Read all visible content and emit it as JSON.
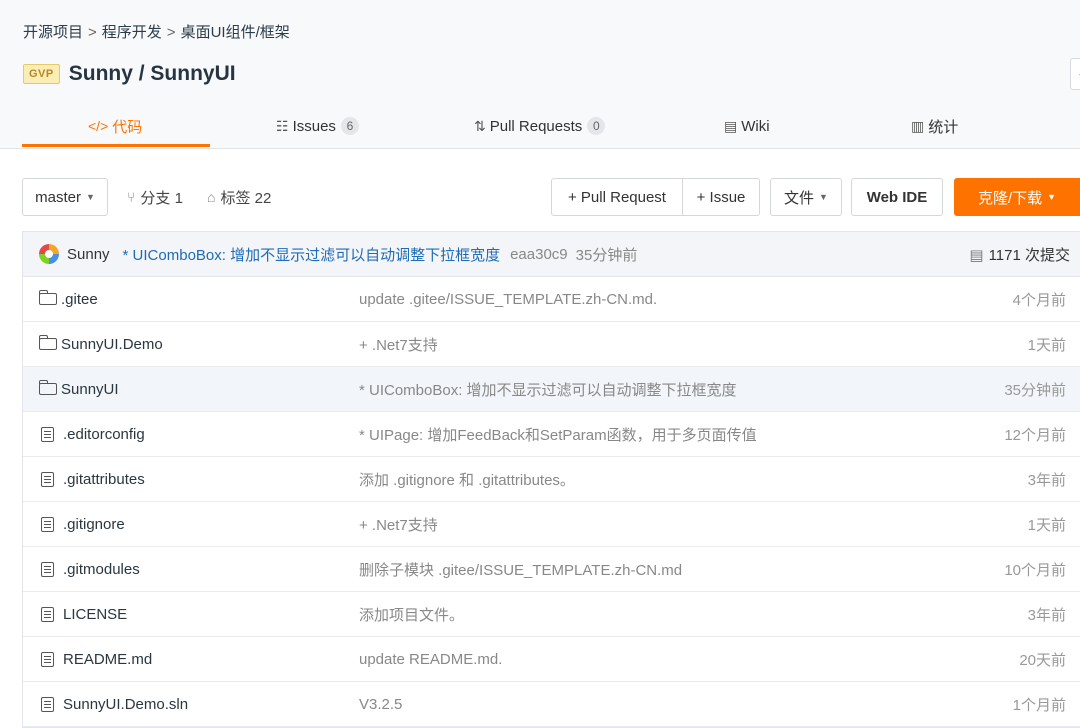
{
  "breadcrumb": [
    "开源项目",
    "程序开发",
    "桌面UI组件/框架"
  ],
  "repo": {
    "badge": "GVP",
    "title": "Sunny / SunnyUI"
  },
  "tabs": [
    {
      "icon": "</>",
      "label": "代码",
      "count": ""
    },
    {
      "icon": "☷",
      "label": "Issues",
      "count": "6"
    },
    {
      "icon": "⇅",
      "label": "Pull Requests",
      "count": "0"
    },
    {
      "icon": "▤",
      "label": "Wiki",
      "count": ""
    },
    {
      "icon": "▥",
      "label": "统计",
      "count": ""
    }
  ],
  "toolbar": {
    "branch": "master",
    "branches_label": "分支 1",
    "tags_label": "标签 22",
    "pull_request": "+ Pull Request",
    "issue": "+ Issue",
    "files": "文件",
    "web_ide": "Web IDE",
    "clone": "克隆/下载"
  },
  "commit": {
    "author": "Sunny",
    "message": "* UIComboBox: 增加不显示过滤可以自动调整下拉框宽度",
    "sha": "eaa30c9",
    "time": "35分钟前",
    "total": "1171 次提交"
  },
  "files": [
    {
      "type": "folder",
      "name": ".gitee",
      "message": "update .gitee/ISSUE_TEMPLATE.zh-CN.md.",
      "time": "4个月前"
    },
    {
      "type": "folder",
      "name": "SunnyUI.Demo",
      "message": "+ .Net7支持",
      "time": "1天前"
    },
    {
      "type": "folder",
      "name": "SunnyUI",
      "message": "* UIComboBox: 增加不显示过滤可以自动调整下拉框宽度",
      "time": "35分钟前"
    },
    {
      "type": "file",
      "name": ".editorconfig",
      "message": "* UIPage: 增加FeedBack和SetParam函数，用于多页面传值",
      "time": "12个月前"
    },
    {
      "type": "file",
      "name": ".gitattributes",
      "message": "添加 .gitignore 和 .gitattributes。",
      "time": "3年前"
    },
    {
      "type": "file",
      "name": ".gitignore",
      "message": "+ .Net7支持",
      "time": "1天前"
    },
    {
      "type": "file",
      "name": ".gitmodules",
      "message": "删除子模块 .gitee/ISSUE_TEMPLATE.zh-CN.md",
      "time": "10个月前"
    },
    {
      "type": "file",
      "name": "LICENSE",
      "message": "添加项目文件。",
      "time": "3年前"
    },
    {
      "type": "file",
      "name": "README.md",
      "message": "update README.md.",
      "time": "20天前"
    },
    {
      "type": "file",
      "name": "SunnyUI.Demo.sln",
      "message": "V3.2.5",
      "time": "1个月前"
    }
  ]
}
